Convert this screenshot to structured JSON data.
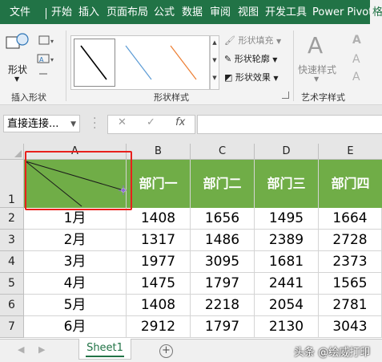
{
  "ribbon": {
    "tabs": [
      "文件",
      "开始",
      "插入",
      "页面布局",
      "公式",
      "数据",
      "审阅",
      "视图",
      "开发工具",
      "Power Pivot",
      "格"
    ],
    "groups": {
      "insert_shapes": {
        "label": "插入形状",
        "shapes_button": "形状"
      },
      "shape_styles": {
        "label": "形状样式",
        "fill": "形状填充",
        "outline": "形状轮廓",
        "effects": "形状效果",
        "gallery_colors": [
          "#000000",
          "#5b9bd5",
          "#ed7d31"
        ]
      },
      "art_text": {
        "label": "艺术字样式",
        "quick_styles": "快速样式",
        "glyph": "A"
      }
    }
  },
  "formula_bar": {
    "name_box": "直接连接...",
    "fx": "fx",
    "value": ""
  },
  "sheet": {
    "columns": [
      "A",
      "B",
      "C",
      "D",
      "E"
    ],
    "row_numbers": [
      "1",
      "2",
      "3",
      "4",
      "5",
      "6",
      "7"
    ],
    "header_row": [
      "",
      "部门一",
      "部门二",
      "部门三",
      "部门四"
    ],
    "header_fill": "#70ad47",
    "rows": [
      [
        "1月",
        "1408",
        "1656",
        "1495",
        "1664"
      ],
      [
        "2月",
        "1317",
        "1486",
        "2389",
        "2728"
      ],
      [
        "3月",
        "1977",
        "3095",
        "1681",
        "2373"
      ],
      [
        "4月",
        "1475",
        "1797",
        "2441",
        "1565"
      ],
      [
        "5月",
        "1408",
        "2218",
        "2054",
        "2781"
      ],
      [
        "6月",
        "2912",
        "1797",
        "2130",
        "3043"
      ]
    ],
    "highlight_color": "#e8201c"
  },
  "bottom": {
    "sheet_tab": "Sheet1",
    "add_sheet": "+",
    "watermark": "头条 @绘威打印"
  }
}
